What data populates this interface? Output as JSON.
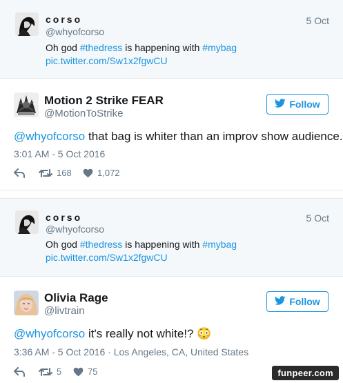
{
  "context_tweet_1": {
    "name": "corso",
    "handle": "@whyofcorso",
    "date": "5 Oct",
    "text_before": "Oh god ",
    "hashtag1": "#thedress",
    "text_middle": " is happening with ",
    "hashtag2": "#mybag",
    "pic_link": "pic.twitter.com/Sw1x2fgwCU"
  },
  "reply_1": {
    "name": "Motion 2 Strike FEAR",
    "handle": "@MotionToStrike",
    "follow_label": "Follow",
    "mention": "@whyofcorso",
    "text": " that bag is whiter than an improv show audience.",
    "timestamp": "3:01 AM - 5 Oct 2016",
    "retweets": "168",
    "likes": "1,072"
  },
  "context_tweet_2": {
    "name": "corso",
    "handle": "@whyofcorso",
    "date": "5 Oct",
    "text_before": "Oh god ",
    "hashtag1": "#thedress",
    "text_middle": " is happening with ",
    "hashtag2": "#mybag",
    "pic_link": "pic.twitter.com/Sw1x2fgwCU"
  },
  "reply_2": {
    "name": "Olivia Rage",
    "handle": "@livtrain",
    "follow_label": "Follow",
    "mention": "@whyofcorso",
    "text": " it's really not white!? ",
    "emoji": "😳",
    "timestamp": "3:36 AM - 5 Oct 2016 · Los Angeles, CA, United States",
    "retweets": "5",
    "likes": "75"
  },
  "watermark": "funpeer.com",
  "colors": {
    "link": "#1b95e0",
    "muted": "#657786",
    "context_bg": "#f5f8fa"
  },
  "icons": [
    "reply-icon",
    "retweet-icon",
    "heart-icon",
    "twitter-bird-icon"
  ]
}
